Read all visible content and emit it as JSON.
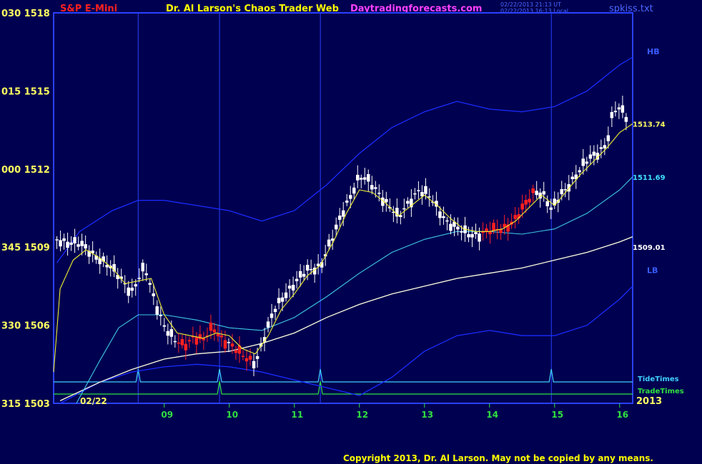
{
  "header": {
    "title": "S&P E-Mini",
    "center": "Dr. Al Larson's Chaos Trader Web",
    "site": "Daytradingforecasts.com",
    "stamp1": "02/22/2013 21:13 UT",
    "stamp2": "02/22/2013 16:13 Local",
    "file": "spkiss.txt"
  },
  "copyright": "Copyright 2013, Dr. Al Larson. May not be copied by any means.",
  "colors": {
    "background": "#000050",
    "frame": "#2a40ff",
    "up_candle": "#ffffff",
    "down_candle": "#ff2020",
    "band": "#1a2cff",
    "slow_ma": "#ffffe0",
    "mid_ma": "#3ec8e8",
    "fast_ma": "#f0f030",
    "tide": "#40d0ff",
    "trade": "#30e040",
    "axis_text": "#ffff60"
  },
  "chart_data": {
    "type": "candlestick",
    "instrument": "S&P E-Mini",
    "y_ticks": [
      {
        "label": "030 1518",
        "value": 1518
      },
      {
        "label": "015 1515",
        "value": 1515
      },
      {
        "label": "000 1512",
        "value": 1512
      },
      {
        "label": "345 1509",
        "value": 1509
      },
      {
        "label": "330 1506",
        "value": 1506
      },
      {
        "label": "315 1503",
        "value": 1503
      }
    ],
    "ylim": [
      1503,
      1518
    ],
    "x_ticks": [
      {
        "label": "09",
        "t": 1.0
      },
      {
        "label": "10",
        "t": 2.0
      },
      {
        "label": "11",
        "t": 3.0
      },
      {
        "label": "12",
        "t": 4.0
      },
      {
        "label": "13",
        "t": 5.0
      },
      {
        "label": "14",
        "t": 6.0
      },
      {
        "label": "15",
        "t": 7.0
      },
      {
        "label": "16",
        "t": 8.0
      }
    ],
    "xlim": [
      -0.7,
      8.2
    ],
    "date_label": "02/22",
    "year_label": "2013",
    "vertical_markers": [
      0.6,
      1.85,
      3.4,
      6.95
    ],
    "band_labels": {
      "upper": "HB",
      "lower": "LB"
    },
    "right_value_labels": [
      {
        "label": "1513.74",
        "value": 1513.74,
        "color": "#ffff60"
      },
      {
        "label": "1511.69",
        "value": 1511.69,
        "color": "#40e0ff"
      },
      {
        "label": "1509.01",
        "value": 1509.01,
        "color": "#ffffff"
      }
    ],
    "line_labels": {
      "tide": "TideTimes",
      "trade": "TradeTimes"
    },
    "tide_pulses": [
      0.6,
      1.85,
      3.4,
      6.95
    ],
    "trade_pulses": [
      1.85,
      3.4
    ],
    "price_path": [
      [
        -0.65,
        1509.3
      ],
      [
        -0.3,
        1509.1
      ],
      [
        0.0,
        1508.6
      ],
      [
        0.3,
        1507.9
      ],
      [
        0.5,
        1507.3
      ],
      [
        0.7,
        1508.2
      ],
      [
        0.85,
        1507.0
      ],
      [
        1.0,
        1506.0
      ],
      [
        1.15,
        1505.4
      ],
      [
        1.3,
        1505.2
      ],
      [
        1.45,
        1505.6
      ],
      [
        1.6,
        1505.4
      ],
      [
        1.75,
        1505.9
      ],
      [
        1.85,
        1505.6
      ],
      [
        2.0,
        1505.3
      ],
      [
        2.2,
        1504.8
      ],
      [
        2.4,
        1504.6
      ],
      [
        2.55,
        1505.6
      ],
      [
        2.7,
        1506.6
      ],
      [
        2.85,
        1507.2
      ],
      [
        3.0,
        1507.6
      ],
      [
        3.2,
        1508.1
      ],
      [
        3.4,
        1508.3
      ],
      [
        3.6,
        1509.4
      ],
      [
        3.75,
        1510.4
      ],
      [
        3.9,
        1511.2
      ],
      [
        4.0,
        1511.7
      ],
      [
        4.15,
        1511.5
      ],
      [
        4.3,
        1511.1
      ],
      [
        4.45,
        1510.6
      ],
      [
        4.6,
        1510.1
      ],
      [
        4.75,
        1510.7
      ],
      [
        4.9,
        1511.2
      ],
      [
        5.05,
        1511.0
      ],
      [
        5.2,
        1510.5
      ],
      [
        5.35,
        1510.0
      ],
      [
        5.5,
        1509.7
      ],
      [
        5.65,
        1509.5
      ],
      [
        5.8,
        1509.5
      ],
      [
        6.0,
        1509.6
      ],
      [
        6.2,
        1509.7
      ],
      [
        6.4,
        1510.1
      ],
      [
        6.55,
        1510.6
      ],
      [
        6.7,
        1511.2
      ],
      [
        6.85,
        1511.0
      ],
      [
        6.95,
        1510.4
      ],
      [
        7.1,
        1511.0
      ],
      [
        7.3,
        1511.7
      ],
      [
        7.5,
        1512.3
      ],
      [
        7.65,
        1512.6
      ],
      [
        7.8,
        1513.0
      ],
      [
        7.9,
        1514.2
      ],
      [
        8.0,
        1514.3
      ],
      [
        8.1,
        1514.0
      ]
    ],
    "down_segments": [
      [
        1.2,
        1.95
      ],
      [
        2.0,
        2.35
      ],
      [
        5.85,
        6.7
      ]
    ],
    "upper_band": [
      [
        -0.65,
        1508.4
      ],
      [
        -0.3,
        1509.6
      ],
      [
        0.2,
        1510.4
      ],
      [
        0.6,
        1510.8
      ],
      [
        1.0,
        1510.8
      ],
      [
        1.5,
        1510.6
      ],
      [
        2.0,
        1510.4
      ],
      [
        2.5,
        1510.0
      ],
      [
        3.0,
        1510.4
      ],
      [
        3.5,
        1511.4
      ],
      [
        4.0,
        1512.6
      ],
      [
        4.5,
        1513.6
      ],
      [
        5.0,
        1514.2
      ],
      [
        5.5,
        1514.6
      ],
      [
        6.0,
        1514.3
      ],
      [
        6.5,
        1514.2
      ],
      [
        7.0,
        1514.4
      ],
      [
        7.5,
        1515.0
      ],
      [
        8.0,
        1516.0
      ],
      [
        8.2,
        1516.3
      ]
    ],
    "lower_band": [
      [
        -0.6,
        1503.0
      ],
      [
        0.0,
        1503.8
      ],
      [
        0.5,
        1504.2
      ],
      [
        1.0,
        1504.4
      ],
      [
        1.5,
        1504.5
      ],
      [
        2.0,
        1504.4
      ],
      [
        2.5,
        1504.2
      ],
      [
        3.0,
        1503.9
      ],
      [
        3.5,
        1503.6
      ],
      [
        4.0,
        1503.3
      ],
      [
        4.5,
        1504.0
      ],
      [
        5.0,
        1505.0
      ],
      [
        5.5,
        1505.6
      ],
      [
        6.0,
        1505.8
      ],
      [
        6.5,
        1505.6
      ],
      [
        7.0,
        1505.6
      ],
      [
        7.5,
        1506.0
      ],
      [
        8.0,
        1507.0
      ],
      [
        8.2,
        1507.5
      ]
    ],
    "slow_ma": [
      [
        -0.6,
        1503.1
      ],
      [
        0.0,
        1503.8
      ],
      [
        0.5,
        1504.3
      ],
      [
        1.0,
        1504.7
      ],
      [
        1.5,
        1504.9
      ],
      [
        2.0,
        1505.0
      ],
      [
        2.5,
        1505.3
      ],
      [
        3.0,
        1505.7
      ],
      [
        3.5,
        1506.3
      ],
      [
        4.0,
        1506.8
      ],
      [
        4.5,
        1507.2
      ],
      [
        5.0,
        1507.5
      ],
      [
        5.5,
        1507.8
      ],
      [
        6.0,
        1508.0
      ],
      [
        6.5,
        1508.2
      ],
      [
        7.0,
        1508.5
      ],
      [
        7.5,
        1508.8
      ],
      [
        8.0,
        1509.2
      ],
      [
        8.2,
        1509.4
      ]
    ],
    "mid_ma": [
      [
        -0.35,
        1503.0
      ],
      [
        0.0,
        1504.6
      ],
      [
        0.3,
        1505.9
      ],
      [
        0.6,
        1506.4
      ],
      [
        1.0,
        1506.4
      ],
      [
        1.5,
        1506.2
      ],
      [
        2.0,
        1505.9
      ],
      [
        2.5,
        1505.8
      ],
      [
        3.0,
        1506.3
      ],
      [
        3.5,
        1507.1
      ],
      [
        4.0,
        1508.0
      ],
      [
        4.5,
        1508.8
      ],
      [
        5.0,
        1509.3
      ],
      [
        5.5,
        1509.6
      ],
      [
        6.0,
        1509.6
      ],
      [
        6.5,
        1509.5
      ],
      [
        7.0,
        1509.7
      ],
      [
        7.5,
        1510.3
      ],
      [
        8.0,
        1511.2
      ],
      [
        8.2,
        1511.7
      ]
    ],
    "fast_ma": [
      [
        -0.7,
        1504.2
      ],
      [
        -0.6,
        1507.4
      ],
      [
        -0.4,
        1508.5
      ],
      [
        -0.2,
        1508.9
      ],
      [
        0.0,
        1508.6
      ],
      [
        0.2,
        1508.2
      ],
      [
        0.4,
        1507.6
      ],
      [
        0.6,
        1507.7
      ],
      [
        0.8,
        1507.8
      ],
      [
        1.0,
        1506.4
      ],
      [
        1.2,
        1505.7
      ],
      [
        1.4,
        1505.6
      ],
      [
        1.6,
        1505.5
      ],
      [
        1.8,
        1505.7
      ],
      [
        2.0,
        1505.6
      ],
      [
        2.2,
        1505.1
      ],
      [
        2.4,
        1504.9
      ],
      [
        2.6,
        1505.6
      ],
      [
        2.8,
        1506.6
      ],
      [
        3.0,
        1507.2
      ],
      [
        3.2,
        1507.9
      ],
      [
        3.4,
        1508.3
      ],
      [
        3.6,
        1509.2
      ],
      [
        3.8,
        1510.3
      ],
      [
        4.0,
        1511.2
      ],
      [
        4.2,
        1511.1
      ],
      [
        4.4,
        1510.7
      ],
      [
        4.6,
        1510.2
      ],
      [
        4.8,
        1510.6
      ],
      [
        5.0,
        1511.0
      ],
      [
        5.2,
        1510.6
      ],
      [
        5.4,
        1510.1
      ],
      [
        5.6,
        1509.7
      ],
      [
        5.8,
        1509.6
      ],
      [
        6.0,
        1509.6
      ],
      [
        6.2,
        1509.7
      ],
      [
        6.4,
        1510.0
      ],
      [
        6.6,
        1510.5
      ],
      [
        6.8,
        1511.0
      ],
      [
        7.0,
        1510.6
      ],
      [
        7.2,
        1511.2
      ],
      [
        7.4,
        1511.8
      ],
      [
        7.6,
        1512.3
      ],
      [
        7.8,
        1512.8
      ],
      [
        8.0,
        1513.4
      ],
      [
        8.2,
        1513.74
      ]
    ]
  }
}
